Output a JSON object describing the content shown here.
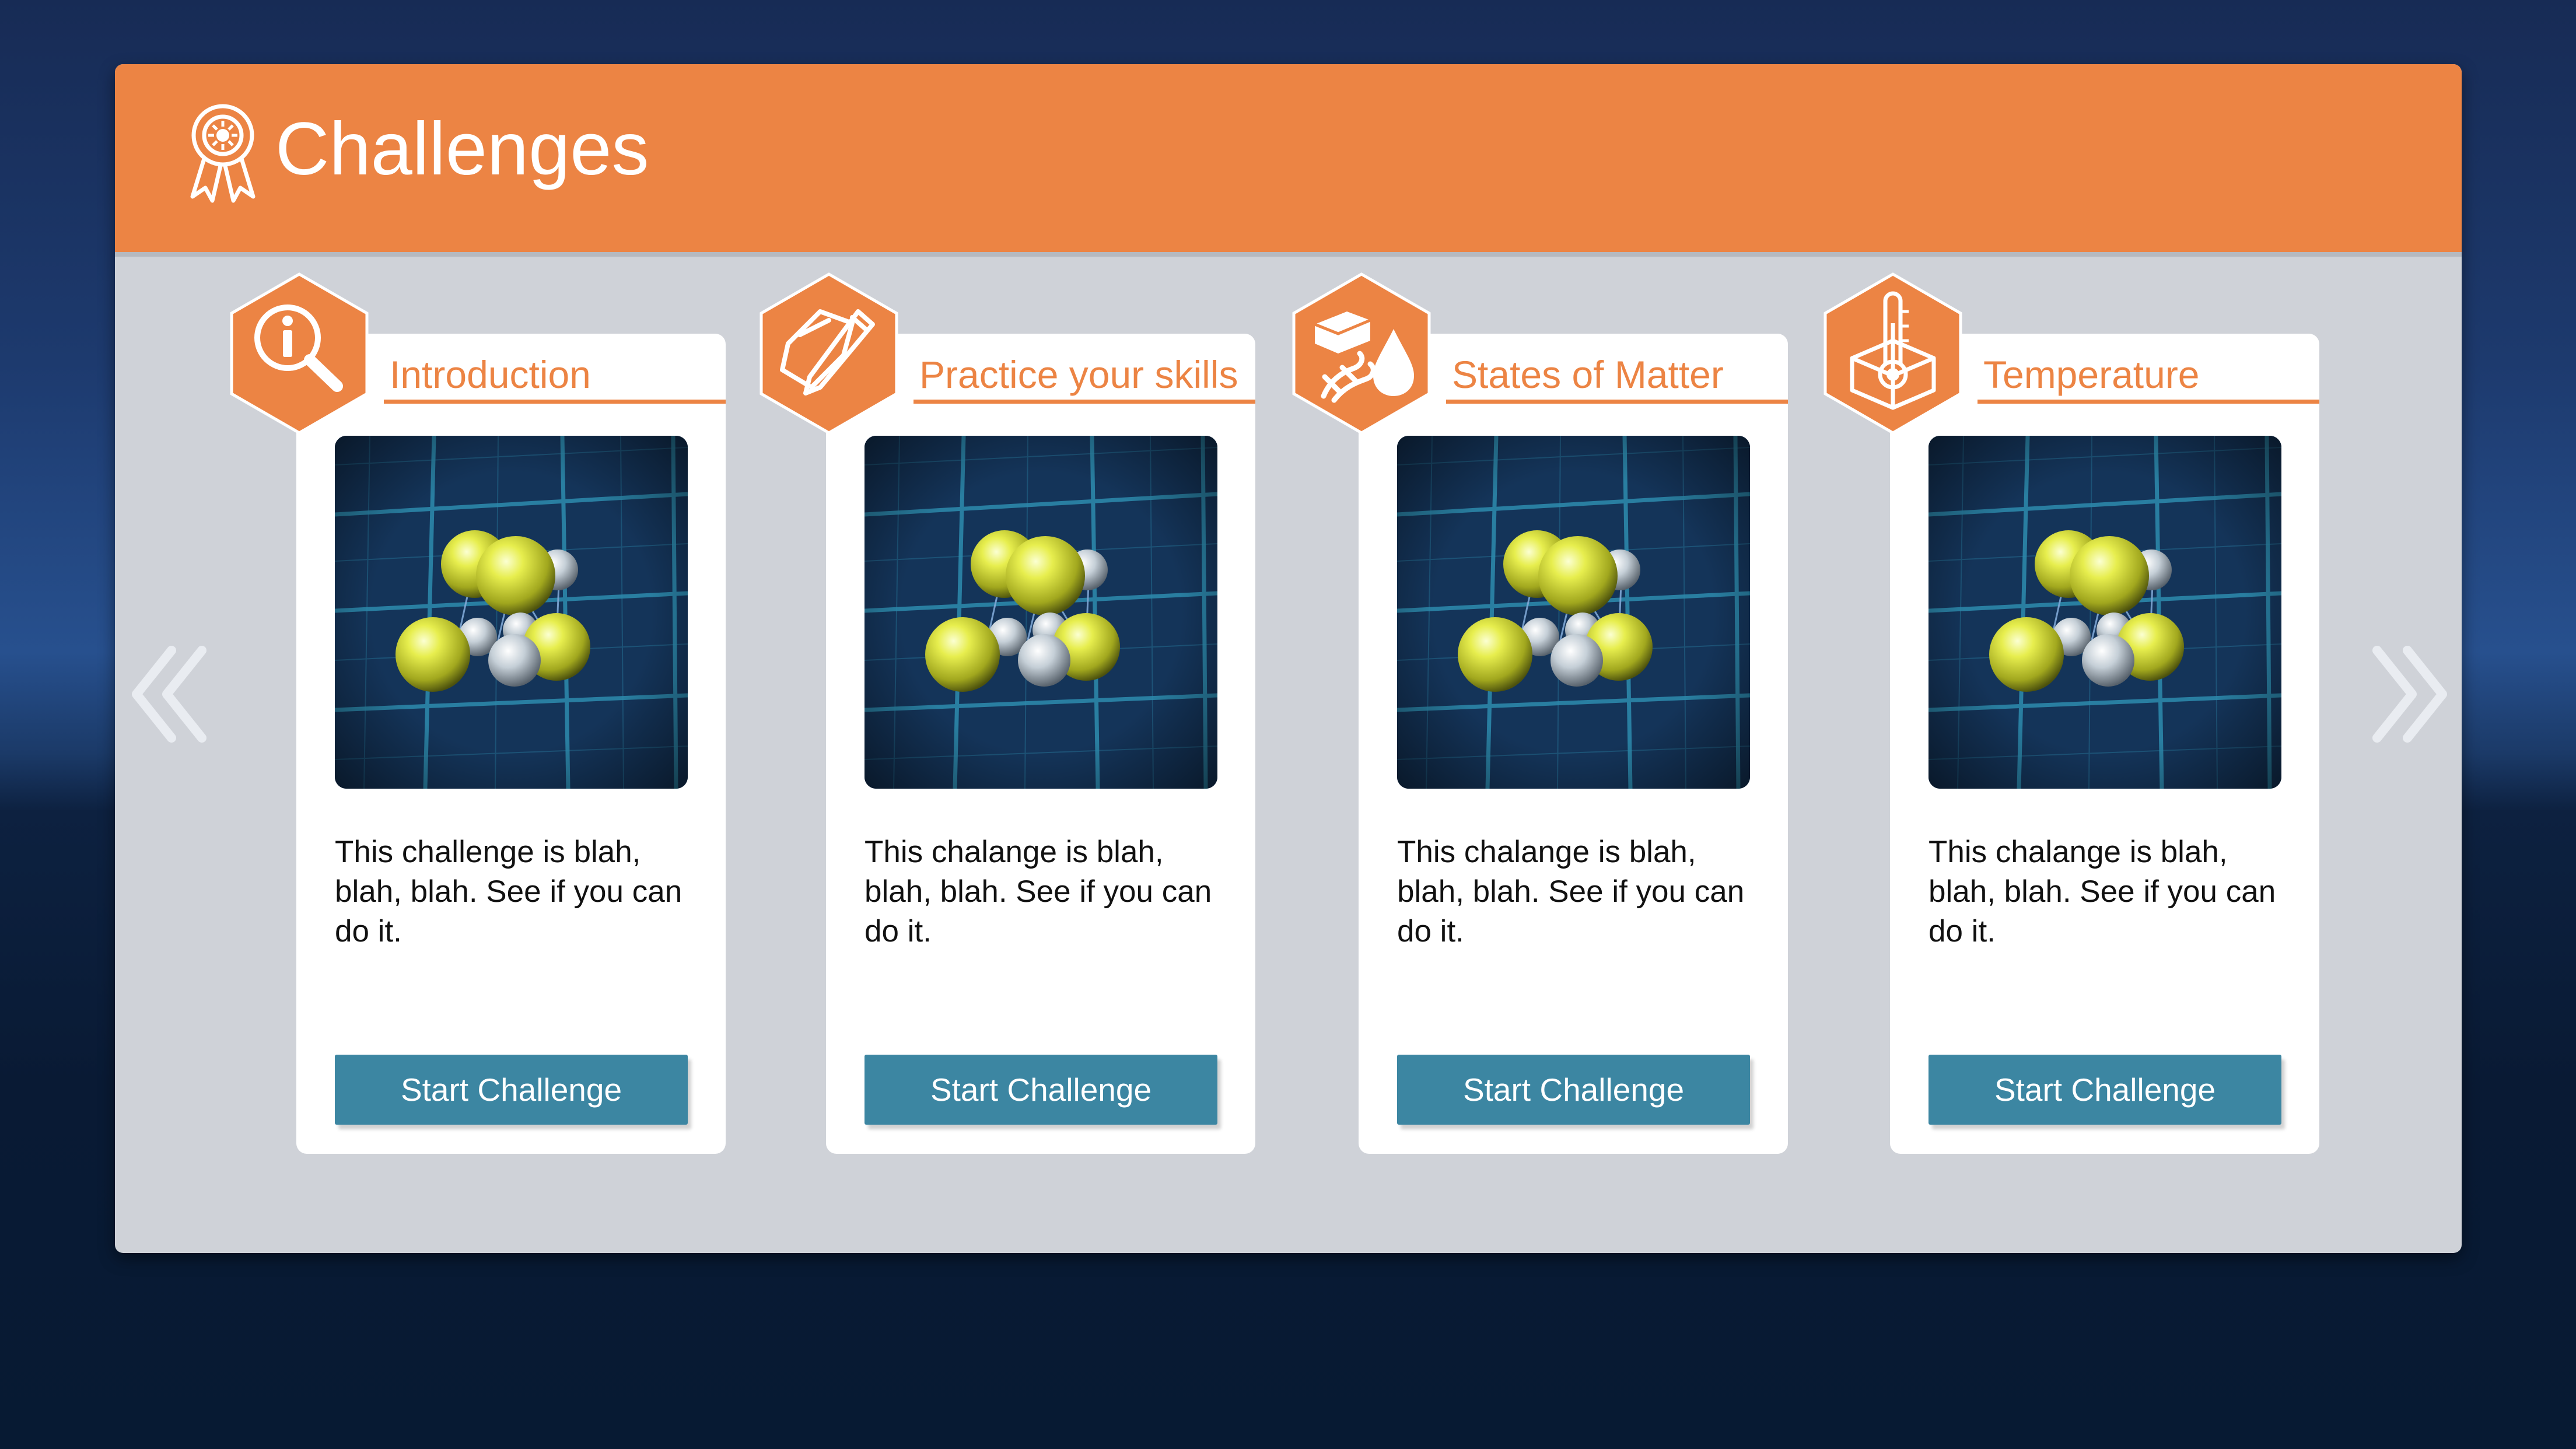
{
  "header": {
    "title": "Challenges",
    "icon": "award-ribbon-icon"
  },
  "nav": {
    "prev_icon": "chevron-double-left-icon",
    "next_icon": "chevron-double-right-icon"
  },
  "colors": {
    "accent": "#ec8444",
    "button": "#3c86a2",
    "panel": "#cfd2d8",
    "background": "#0b2040"
  },
  "cards": [
    {
      "title": "Introduction",
      "icon": "info-magnifier-icon",
      "description": "This challenge is blah, blah, blah. See if you can do it.",
      "button_label": "Start Challenge"
    },
    {
      "title": "Practice your skills",
      "icon": "paper-pencil-icon",
      "description": "This chalange is blah, blah, blah. See if you can do it.",
      "button_label": "Start Challenge"
    },
    {
      "title": "States of Matter",
      "icon": "states-of-matter-icon",
      "description": "This chalange is blah, blah, blah. See if you can do it.",
      "button_label": "Start Challenge"
    },
    {
      "title": "Temperature",
      "icon": "thermometer-icon",
      "description": "This chalange is blah, blah, blah. See if you can do it.",
      "button_label": "Start Challenge"
    }
  ]
}
